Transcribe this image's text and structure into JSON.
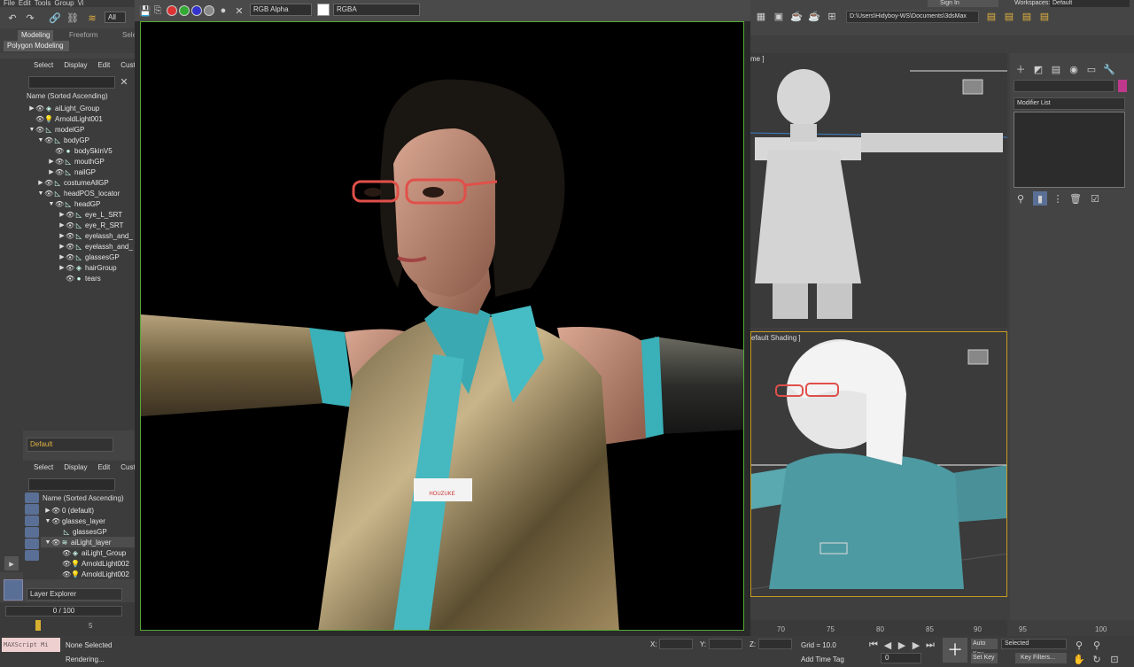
{
  "menu": [
    "File",
    "Edit",
    "Tools",
    "Group",
    "Vi"
  ],
  "ribbon": {
    "tab_modeling": "Modeling",
    "tab_freeform": "Freeform",
    "tab_sel": "Sele",
    "polygon_modeling": "Polygon Modeling",
    "selection_filter": "All"
  },
  "scene_explorer": {
    "tabs": [
      "Select",
      "Display",
      "Edit",
      "Cust"
    ],
    "column": "Name (Sorted Ascending)",
    "items": [
      {
        "label": "aiLight_Group"
      },
      {
        "label": "ArnoldLight001"
      },
      {
        "label": "modelGP"
      },
      {
        "label": "bodyGP"
      },
      {
        "label": "bodySkinV5"
      },
      {
        "label": "mouthGP"
      },
      {
        "label": "nailGP"
      },
      {
        "label": "costumeAllGP"
      },
      {
        "label": "headPOS_locator"
      },
      {
        "label": "headGP"
      },
      {
        "label": "eye_L_SRT"
      },
      {
        "label": "eye_R_SRT"
      },
      {
        "label": "eyelassh_and_"
      },
      {
        "label": "eyelassh_and_"
      },
      {
        "label": "glassesGP"
      },
      {
        "label": "hairGroup"
      },
      {
        "label": "tears"
      }
    ],
    "layer_default": "Default"
  },
  "layer_explorer": {
    "tabs": [
      "Select",
      "Display",
      "Edit",
      "Cust"
    ],
    "column": "Name (Sorted Ascending)",
    "items": [
      {
        "label": "0 (default)"
      },
      {
        "label": "glasses_layer"
      },
      {
        "label": "glassesGP"
      },
      {
        "label": "aiLight_layer"
      },
      {
        "label": "aiLight_Group"
      },
      {
        "label": "ArnoldLight002"
      },
      {
        "label": "ArnoldLight002"
      }
    ],
    "dropdown": "Layer Explorer"
  },
  "timeslider": {
    "frame": "0 / 100",
    "ticks": [
      "5",
      "70",
      "75",
      "80",
      "85",
      "90",
      "95",
      "100"
    ]
  },
  "vfb": {
    "channel": "RGB Alpha",
    "display": "RGBA",
    "name_tag": "HOUZUKE"
  },
  "right": {
    "sign_in": "Sign In",
    "workspaces_label": "Workspaces:",
    "workspaces_value": "Default",
    "path": "D:\\Users\\Hidyboy-WS\\Documents\\3dsMax",
    "vp1_label": "me ]",
    "vp2_label": "efault Shading ]",
    "modifier_list": "Modifier List"
  },
  "status": {
    "maxscript": "MAXScript Mi",
    "selected": "None Selected",
    "rendering": "Rendering...",
    "x_label": "X:",
    "y_label": "Y:",
    "z_label": "Z:",
    "grid": "Grid = 10.0",
    "add_time_tag": "Add Time Tag",
    "auto_key": "Auto Key",
    "selected_dropdown": "Selected",
    "set_key": "Set Key",
    "key_filters": "Key Filters...",
    "frame_value": "0"
  },
  "colors": {
    "accent_selected": "#5a6f95",
    "render_border": "#55aa33",
    "viewport_active": "#c89a20"
  }
}
